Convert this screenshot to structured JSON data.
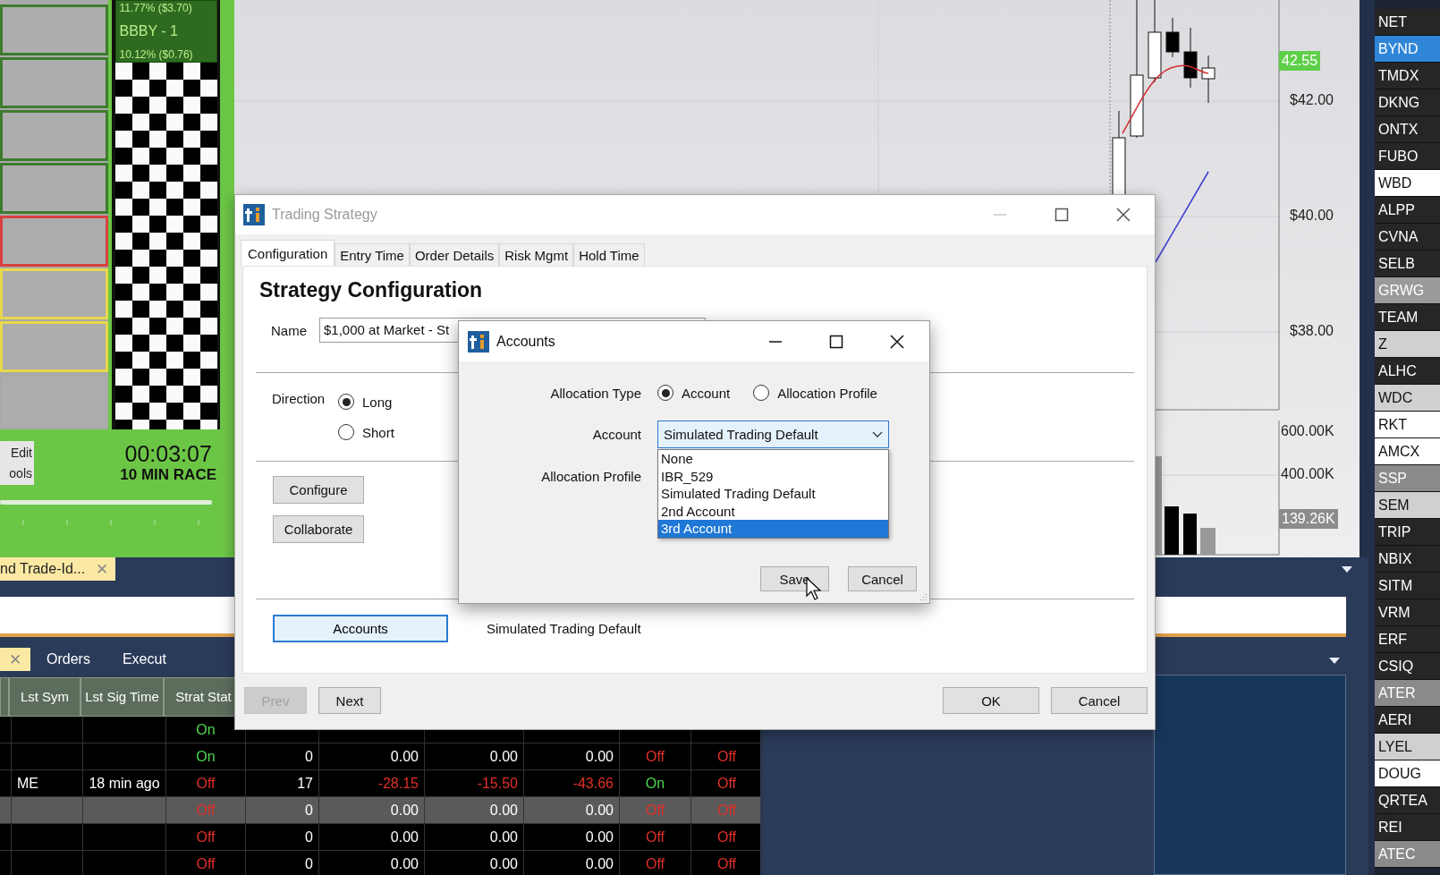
{
  "race": {
    "leader_change": "11.77% ($3.70)",
    "leader_name": "BBBY - 1",
    "leader_gain": "10.12% ($0.76)",
    "lanes": [
      {
        "color": "#3d7b2e"
      },
      {
        "color": "#3d7b2e"
      },
      {
        "color": "#3d7b2e"
      },
      {
        "color": "#3d7b2e"
      },
      {
        "color": "#d94040"
      },
      {
        "color": "#e8d84e"
      },
      {
        "color": "#e8d84e"
      },
      {
        "color": "#a9a9a9"
      }
    ],
    "edit_button": "Edit ools",
    "timer": "00:03:07",
    "race_name": "10 MIN RACE"
  },
  "chart": {
    "last_price": "42.55",
    "price_labels": [
      "$42.00",
      "$40.00",
      "$38.00"
    ],
    "volume_labels": [
      "600.00K",
      "400.00K"
    ],
    "last_volume": "139.26K"
  },
  "tickers": [
    {
      "symbol": "NET",
      "color": "#262626"
    },
    {
      "symbol": "BYND",
      "color": "#2f86d8"
    },
    {
      "symbol": "TMDX",
      "color": "#262626"
    },
    {
      "symbol": "DKNG",
      "color": "#262626"
    },
    {
      "symbol": "ONTX",
      "color": "#262626"
    },
    {
      "symbol": "FUBO",
      "color": "#262626"
    },
    {
      "symbol": "WBD",
      "color": "#ffffff"
    },
    {
      "symbol": "ALPP",
      "color": "#262626"
    },
    {
      "symbol": "CVNA",
      "color": "#262626"
    },
    {
      "symbol": "SELB",
      "color": "#262626"
    },
    {
      "symbol": "GRWG",
      "color": "#9a9a9a"
    },
    {
      "symbol": "TEAM",
      "color": "#262626"
    },
    {
      "symbol": "Z",
      "color": "#d0d0d0"
    },
    {
      "symbol": "ALHC",
      "color": "#262626"
    },
    {
      "symbol": "WDC",
      "color": "#d0d0d0"
    },
    {
      "symbol": "RKT",
      "color": "#ffffff"
    },
    {
      "symbol": "AMCX",
      "color": "#ffffff"
    },
    {
      "symbol": "SSP",
      "color": "#8a8a8a"
    },
    {
      "symbol": "SEM",
      "color": "#d0d0d0"
    },
    {
      "symbol": "TRIP",
      "color": "#262626"
    },
    {
      "symbol": "NBIX",
      "color": "#262626"
    },
    {
      "symbol": "SITM",
      "color": "#262626"
    },
    {
      "symbol": "VRM",
      "color": "#262626"
    },
    {
      "symbol": "ERF",
      "color": "#262626"
    },
    {
      "symbol": "CSIQ",
      "color": "#262626"
    },
    {
      "symbol": "ATER",
      "color": "#8a8a8a"
    },
    {
      "symbol": "AERI",
      "color": "#262626"
    },
    {
      "symbol": "LYEL",
      "color": "#d0d0d0"
    },
    {
      "symbol": "DOUG",
      "color": "#ffffff"
    },
    {
      "symbol": "QRTEA",
      "color": "#262626"
    },
    {
      "symbol": "REI",
      "color": "#262626"
    },
    {
      "symbol": "ATEC",
      "color": "#8a8a8a"
    }
  ],
  "upper_tab": {
    "label": "nd Trade-Id...",
    "close": "✕"
  },
  "lower_tabs": [
    {
      "close": "✕",
      "selected": true
    },
    {
      "label": "Orders",
      "selected": false
    },
    {
      "label": "Execut",
      "selected": false
    }
  ],
  "table": {
    "columns": [
      "Lst Sym",
      "Lst Sig Time",
      "Strat Stat"
    ],
    "rows": [
      {
        "status": {
          "text": "On",
          "on": true
        },
        "selected": false
      },
      {
        "status": {
          "text": "On",
          "on": true
        },
        "values": [
          "0",
          "0.00",
          "0.00",
          "0.00"
        ],
        "loss": false,
        "flags": [
          {
            "text": "Off",
            "on": false
          },
          {
            "text": "Off",
            "on": false
          }
        ],
        "selected": false
      },
      {
        "symbol": "ME",
        "time": "18 min ago",
        "status": {
          "text": "Off",
          "on": false
        },
        "values": [
          "17",
          "-28.15",
          "-15.50",
          "-43.66"
        ],
        "loss": true,
        "flags": [
          {
            "text": "On",
            "on": true
          },
          {
            "text": "Off",
            "on": false
          }
        ],
        "selected": false
      },
      {
        "status": {
          "text": "Off",
          "on": false
        },
        "values": [
          "0",
          "0.00",
          "0.00",
          "0.00"
        ],
        "loss": false,
        "flags": [
          {
            "text": "Off",
            "on": false
          },
          {
            "text": "Off",
            "on": false
          }
        ],
        "selected": true
      },
      {
        "status": {
          "text": "Off",
          "on": false
        },
        "values": [
          "0",
          "0.00",
          "0.00",
          "0.00"
        ],
        "loss": false,
        "flags": [
          {
            "text": "Off",
            "on": false
          },
          {
            "text": "Off",
            "on": false
          }
        ],
        "selected": false
      },
      {
        "status": {
          "text": "Off",
          "on": false
        },
        "values": [
          "0",
          "0.00",
          "0.00",
          "0.00"
        ],
        "loss": false,
        "flags": [
          {
            "text": "Off",
            "on": false
          },
          {
            "text": "Off",
            "on": false
          }
        ],
        "selected": false
      }
    ]
  },
  "strategy": {
    "title": "Trading Strategy",
    "active": false,
    "tabs": [
      {
        "label": "Configuration",
        "selected": true
      },
      {
        "label": "Entry Time",
        "selected": false
      },
      {
        "label": "Order Details",
        "selected": false
      },
      {
        "label": "Risk Mgmt",
        "selected": false
      },
      {
        "label": "Hold Time",
        "selected": false
      }
    ],
    "heading": "Strategy Configuration",
    "name_label": "Name",
    "name_value": "$1,000 at Market - St",
    "direction_label": "Direction",
    "directions": [
      {
        "label": "Long",
        "selected": true
      },
      {
        "label": "Short",
        "selected": false
      }
    ],
    "buttons": [
      "Configure",
      "Collaborate"
    ],
    "accounts_button": "Accounts",
    "account_value": "Simulated Trading Default",
    "footer": [
      {
        "label": "Prev",
        "disabled": true
      },
      {
        "label": "Next",
        "disabled": false
      }
    ],
    "footer_right": [
      "OK",
      "Cancel"
    ]
  },
  "accounts": {
    "title": "Accounts",
    "allocation_type_label": "Allocation Type",
    "allocation_types": [
      {
        "label": "Account",
        "selected": true
      },
      {
        "label": "Allocation Profile",
        "selected": false
      }
    ],
    "account_label": "Account",
    "account_value": "Simulated Trading Default",
    "options": [
      {
        "label": "None",
        "selected": false
      },
      {
        "label": "IBR_529",
        "selected": false
      },
      {
        "label": "Simulated Trading Default",
        "selected": false
      },
      {
        "label": "2nd Account",
        "selected": false
      },
      {
        "label": "3rd Account",
        "selected": true
      }
    ],
    "profile_label": "Allocation Profile",
    "buttons": [
      "Save",
      "Cancel"
    ]
  }
}
